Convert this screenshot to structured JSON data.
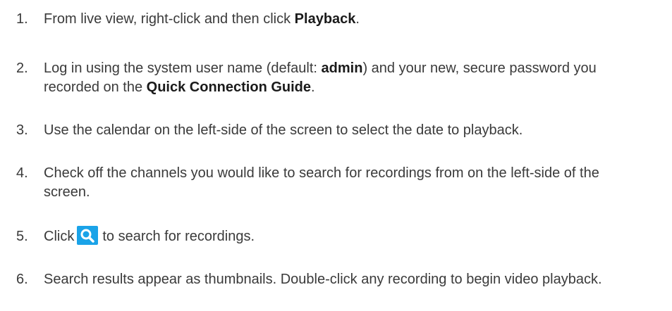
{
  "steps": [
    {
      "number": "1.",
      "before": "From live view, right-click and then click ",
      "bold": "Playback",
      "after": "."
    },
    {
      "number": "2.",
      "before": "Log in using the system user name (default: ",
      "bold1": "admin",
      "middle": ") and your new, secure password you recorded on the ",
      "bold2": "Quick Connection Guide",
      "after": "."
    },
    {
      "number": "3.",
      "text": "Use the calendar on the left-side of the screen to select the date to playback."
    },
    {
      "number": "4.",
      "text": "Check off the channels you would like to search for recordings from on the left-side of the screen."
    },
    {
      "number": "5.",
      "before": "Click",
      "icon": "search-icon",
      "after": "to search for recordings."
    },
    {
      "number": "6.",
      "text": "Search results appear as thumbnails. Double-click any recording to begin video playback."
    }
  ],
  "colors": {
    "text": "#3a3a3a",
    "icon_bg": "#1aa3e8",
    "icon_fg": "#ffffff"
  }
}
